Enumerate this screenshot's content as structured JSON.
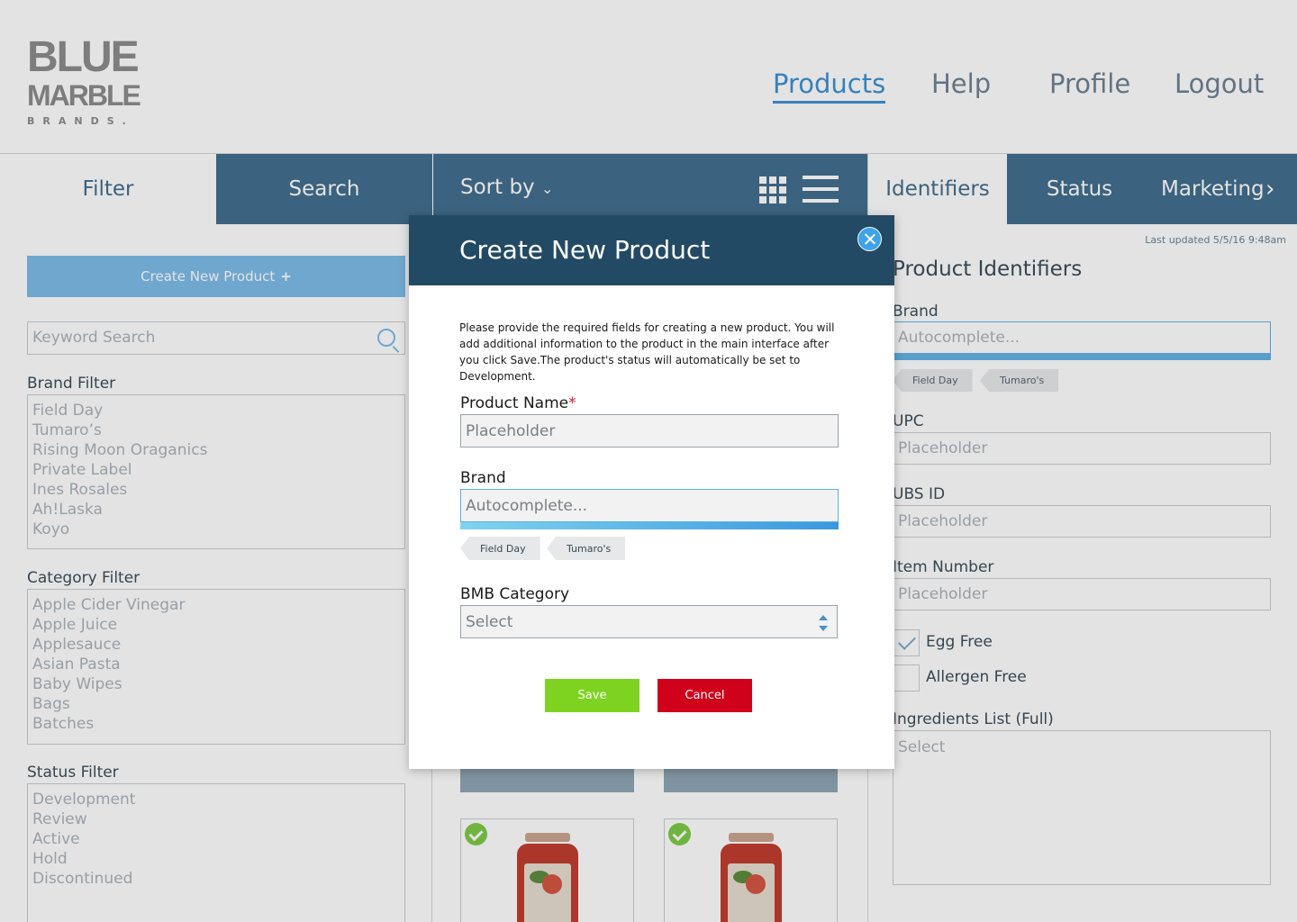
{
  "logo": {
    "line1": "BLUE",
    "line2": "MARBLE",
    "line3": "BRANDS."
  },
  "nav": {
    "items": [
      "Products",
      "Help",
      "Profile",
      "Logout"
    ],
    "active": "Products"
  },
  "toolbar": {
    "filter": "Filter",
    "search": "Search",
    "sort_label": "Sort by",
    "right_tabs": [
      "Identifiers",
      "Status",
      "Marketing"
    ]
  },
  "sidebar": {
    "create_label": "Create New Product",
    "keyword_placeholder": "Keyword Search",
    "brand_filter": {
      "label": "Brand Filter",
      "options": [
        "Field Day",
        "Tumaro’s",
        "Rising Moon Oraganics",
        "Private Label",
        "Ines Rosales",
        "Ah!Laska",
        "Koyo"
      ]
    },
    "category_filter": {
      "label": "Category Filter",
      "options": [
        "Apple Cider Vinegar",
        "Apple Juice",
        "Applesauce",
        "Asian Pasta",
        "Baby Wipes",
        "Bags",
        "Batches"
      ]
    },
    "status_filter": {
      "label": "Status Filter",
      "options": [
        "Development",
        "Review",
        "Active",
        "Hold",
        "Discontinued"
      ]
    }
  },
  "details": {
    "last_updated": "Last updated 5/5/16 9:48am",
    "title": "Product Identifiers",
    "brand_label": "Brand",
    "brand_placeholder": "Autocomplete...",
    "brand_chips": [
      "Field Day",
      "Tumaro's"
    ],
    "upc_label": "UPC",
    "upc_placeholder": "Placeholder",
    "ubs_label": "UBS ID",
    "ubs_placeholder": "Placeholder",
    "item_label": "Item Number",
    "item_placeholder": "Placeholder",
    "egg_free": "Egg Free",
    "allergen_free": "Allergen Free",
    "ingredients_label": "Ingredients List (Full)",
    "ingredients_placeholder": "Select"
  },
  "modal": {
    "title": "Create New Product",
    "intro": "Please provide the required fields for creating a new product. You will add additional information to the product in the main interface  after you click Save.The product's status will automatically be set to Development.",
    "product_name_label": "Product Name",
    "required_mark": "*",
    "product_name_placeholder": "Placeholder",
    "brand_label": "Brand",
    "brand_placeholder": "Autocomplete...",
    "brand_chips": [
      "Field Day",
      "Tumaro's"
    ],
    "category_label": "BMB Category",
    "category_value": "Select",
    "save_label": "Save",
    "cancel_label": "Cancel"
  },
  "colors": {
    "header_blue": "#234a64",
    "accent_blue": "#3a8fd0",
    "save_green": "#7ed321",
    "cancel_red": "#d0021b"
  }
}
